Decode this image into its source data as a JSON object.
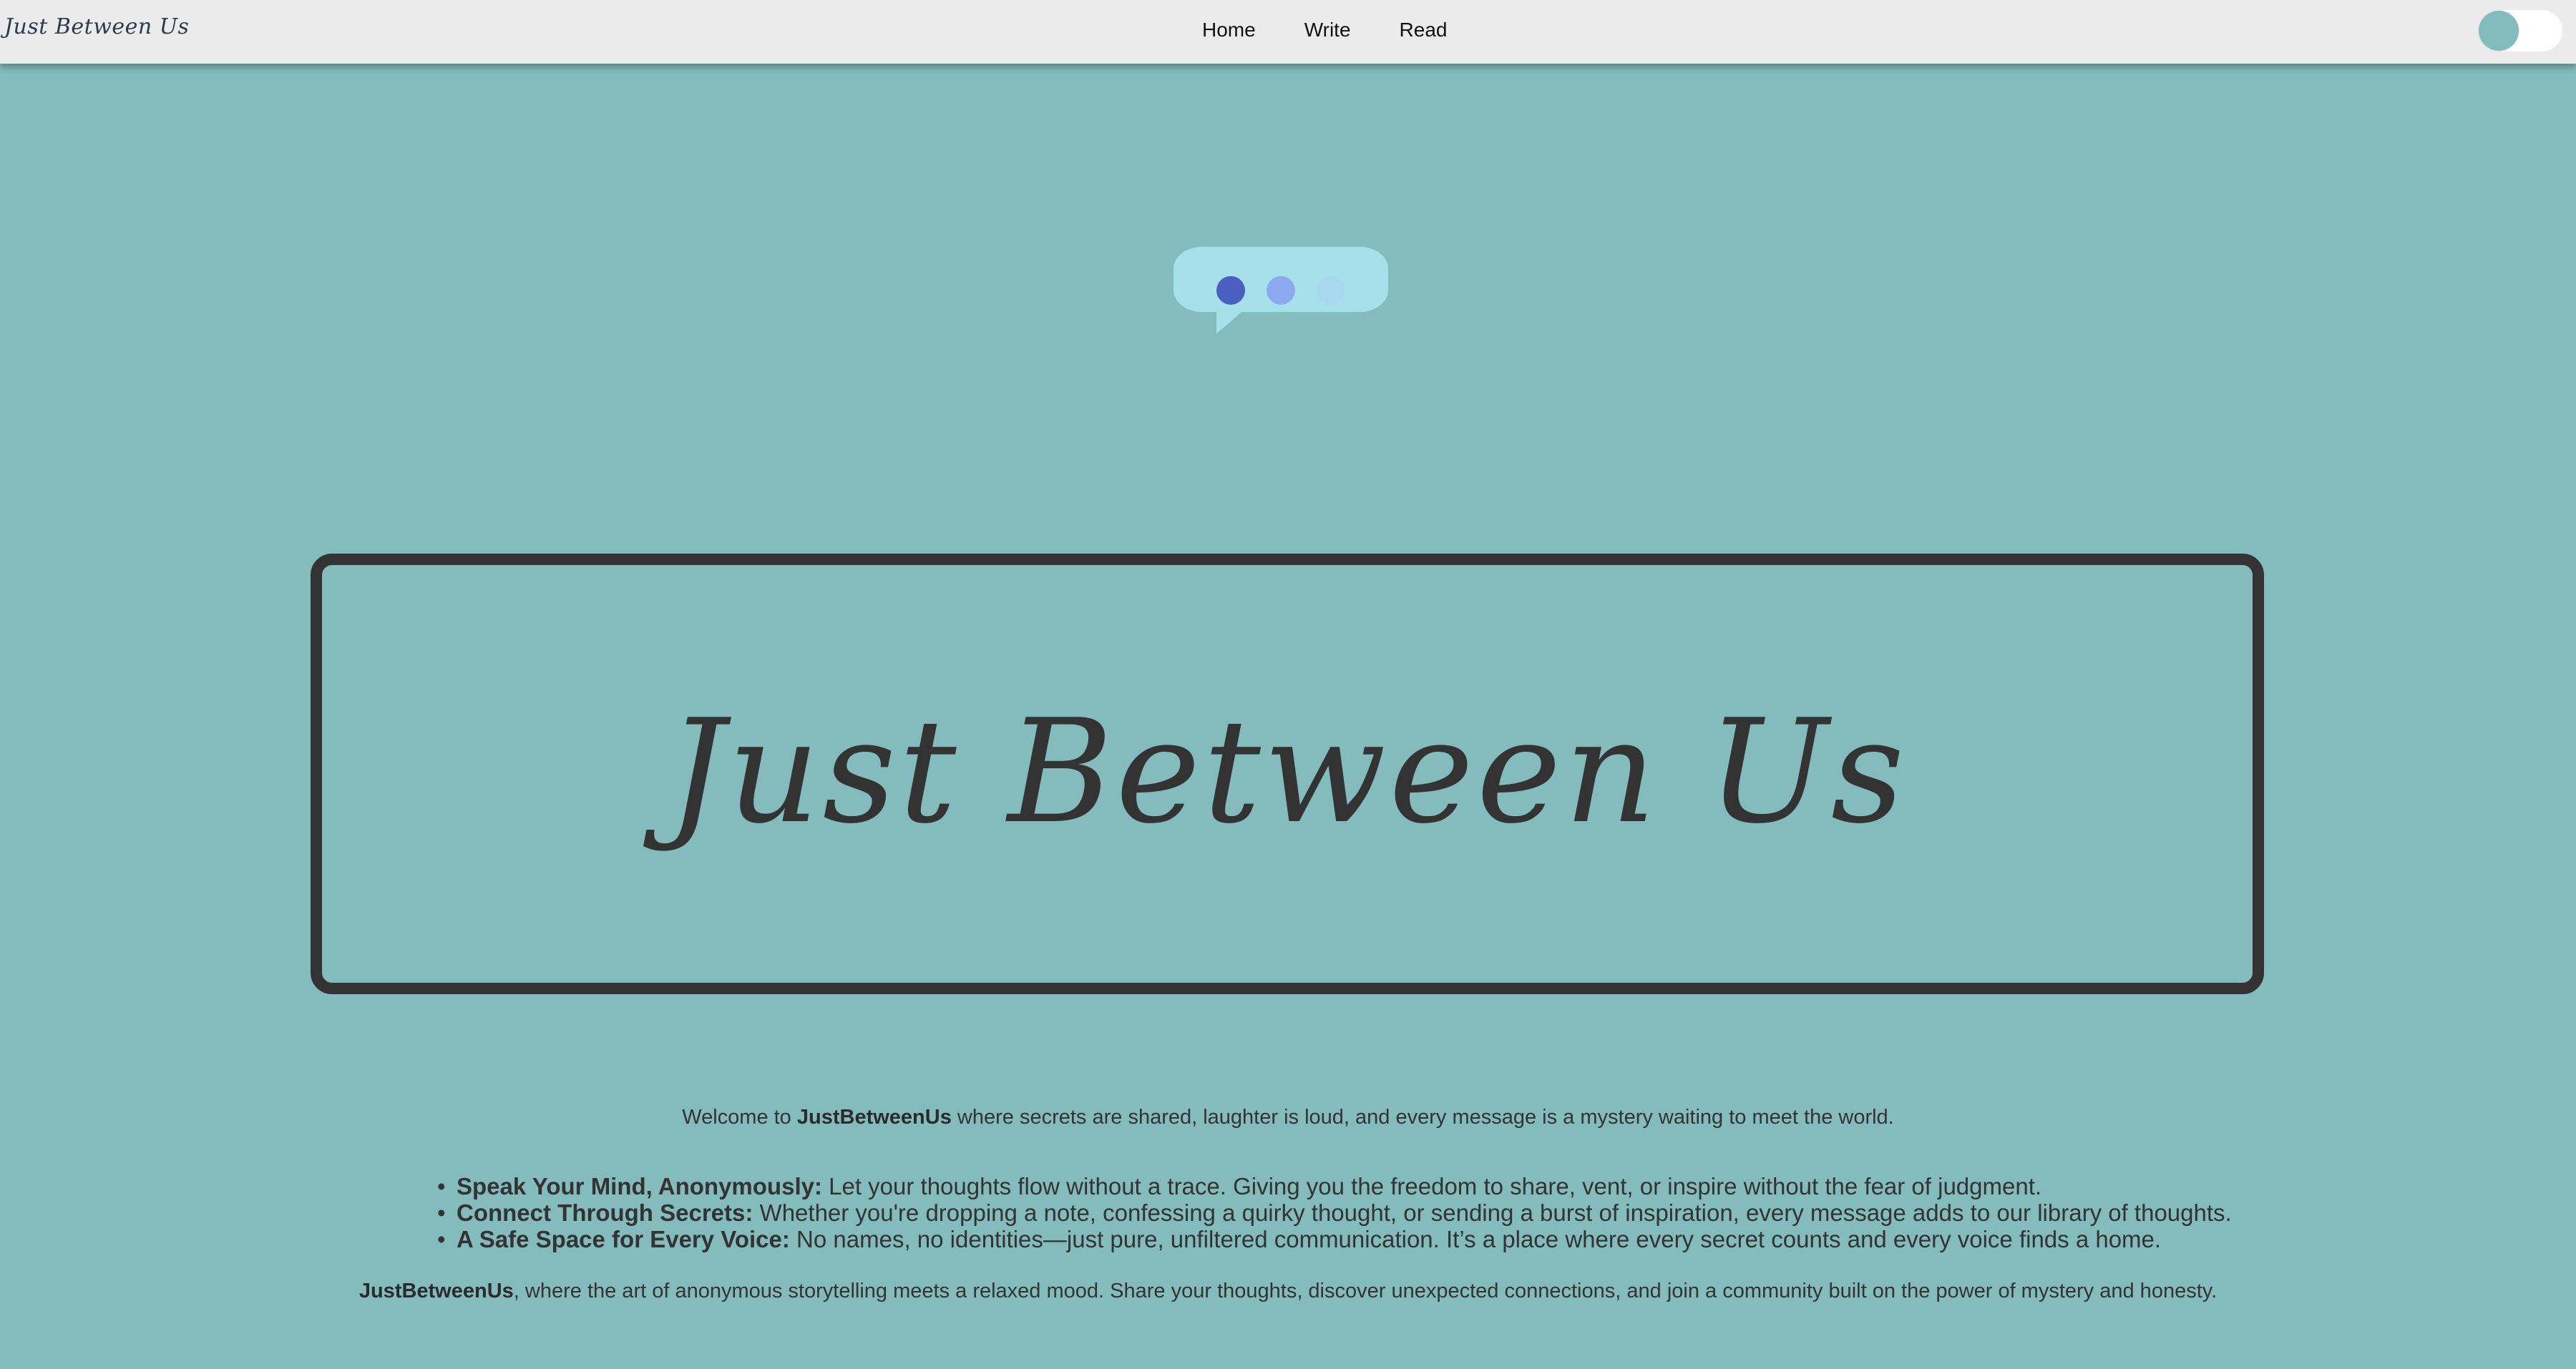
{
  "nav": {
    "brand": "Just Between Us",
    "links": [
      "Home",
      "Write",
      "Read"
    ]
  },
  "theme_toggle": {
    "state": "off"
  },
  "bubble_icon": {
    "dot_colors": [
      "#4a5fc1",
      "#8fa8f2",
      "#a8d8f0"
    ],
    "bubble_color": "#a6e1ea"
  },
  "hero": {
    "title": "Just Between Us"
  },
  "intro": {
    "prefix": "Welcome to ",
    "brand": "JustBetweenUs",
    "suffix": " where secrets are shared, laughter is loud, and every message is a mystery waiting to meet the world."
  },
  "features": [
    {
      "title": "Speak Your Mind, Anonymously:",
      "text": " Let your thoughts flow without a trace. Giving you the freedom to share, vent, or inspire without the fear of judgment."
    },
    {
      "title": "Connect Through Secrets:",
      "text": " Whether you're dropping a note, confessing a quirky thought, or sending a burst of inspiration, every message adds to our library of thoughts."
    },
    {
      "title": "A Safe Space for Every Voice:",
      "text": " No names, no identities—just pure, unfiltered communication. It’s a place where every secret counts and every voice finds a home."
    }
  ],
  "closing": {
    "brand": "JustBetweenUs",
    "text": ", where the art of anonymous storytelling meets a relaxed mood. Share your thoughts, discover unexpected connections, and join a community built on the power of mystery and honesty."
  },
  "colors": {
    "background": "#84bbbd",
    "navbar": "#ebebeb",
    "text": "#333333"
  }
}
